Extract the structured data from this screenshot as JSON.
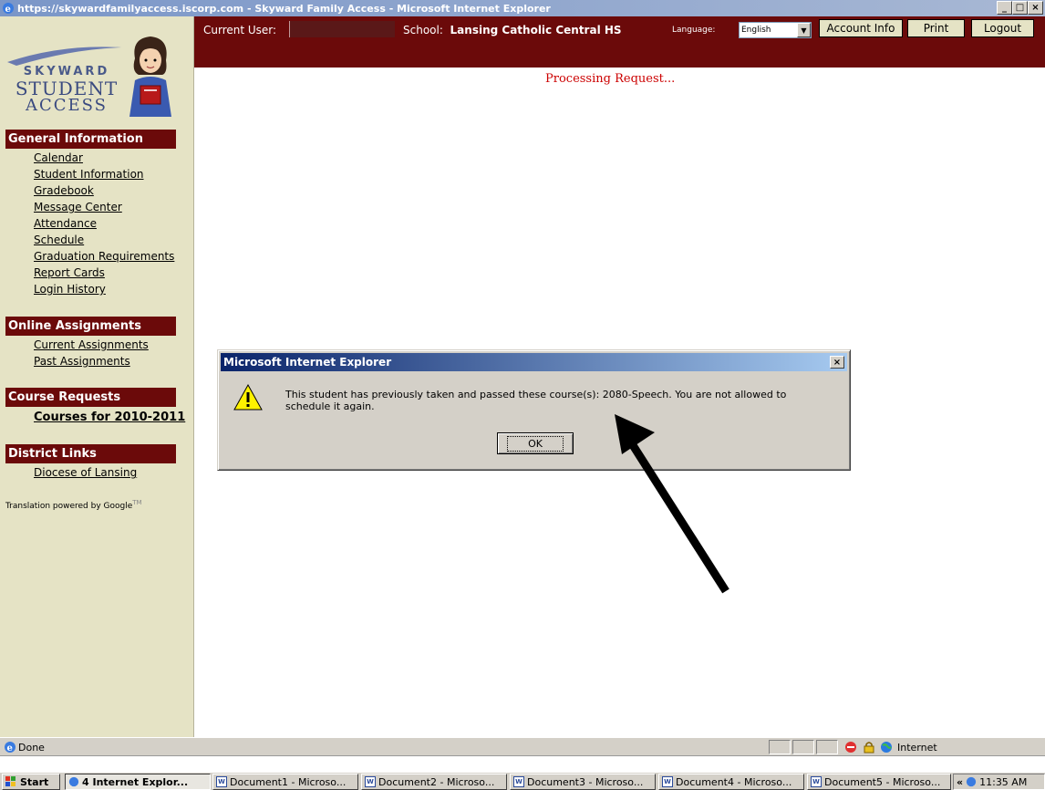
{
  "window": {
    "title": "https://skywardfamilyaccess.iscorp.com - Skyward Family Access - Microsoft Internet Explorer",
    "controls": [
      "_",
      "□",
      "×"
    ]
  },
  "logo": {
    "line1": "SKYWARD",
    "line2": "STUDENT",
    "line3": "ACCESS"
  },
  "header": {
    "current_user_label": "Current User:",
    "school_label": "School:",
    "school_name": "Lansing Catholic Central HS",
    "language_label": "Language:",
    "language_value": "English",
    "account_info": "Account Info",
    "print": "Print",
    "logout": "Logout"
  },
  "sidebar": {
    "general_header": "General Information",
    "general_links": [
      "Calendar",
      "Student Information",
      "Gradebook",
      "Message Center",
      "Attendance",
      "Schedule",
      "Graduation Requirements",
      "Report Cards",
      "Login History"
    ],
    "online_header": "Online Assignments",
    "online_links": [
      "Current Assignments",
      "Past Assignments"
    ],
    "course_header": "Course Requests",
    "course_links": [
      "Courses for 2010-2011"
    ],
    "district_header": "District Links",
    "district_links": [
      "Diocese of Lansing"
    ],
    "translation": "Translation powered by Google",
    "translation_tm": "TM"
  },
  "main": {
    "processing": "Processing Request..."
  },
  "dialog": {
    "title": "Microsoft Internet Explorer",
    "message": "This student has previously taken and passed these course(s): 2080-Speech.  You are not allowed to schedule it again.",
    "ok": "OK"
  },
  "statusbar": {
    "text": "Done",
    "zone": "Internet"
  },
  "taskbar": {
    "start": "Start",
    "tasks": [
      "4 Internet Explor...",
      "Document1 - Microso...",
      "Document2 - Microso...",
      "Document3 - Microso...",
      "Document4 - Microso...",
      "Document5 - Microso..."
    ],
    "tray_chevron": "«",
    "clock": "11:35 AM"
  },
  "colors": {
    "maroon": "#6b0a0a",
    "sidebar_bg": "#e5e3c5",
    "processing_red": "#cc0000"
  }
}
